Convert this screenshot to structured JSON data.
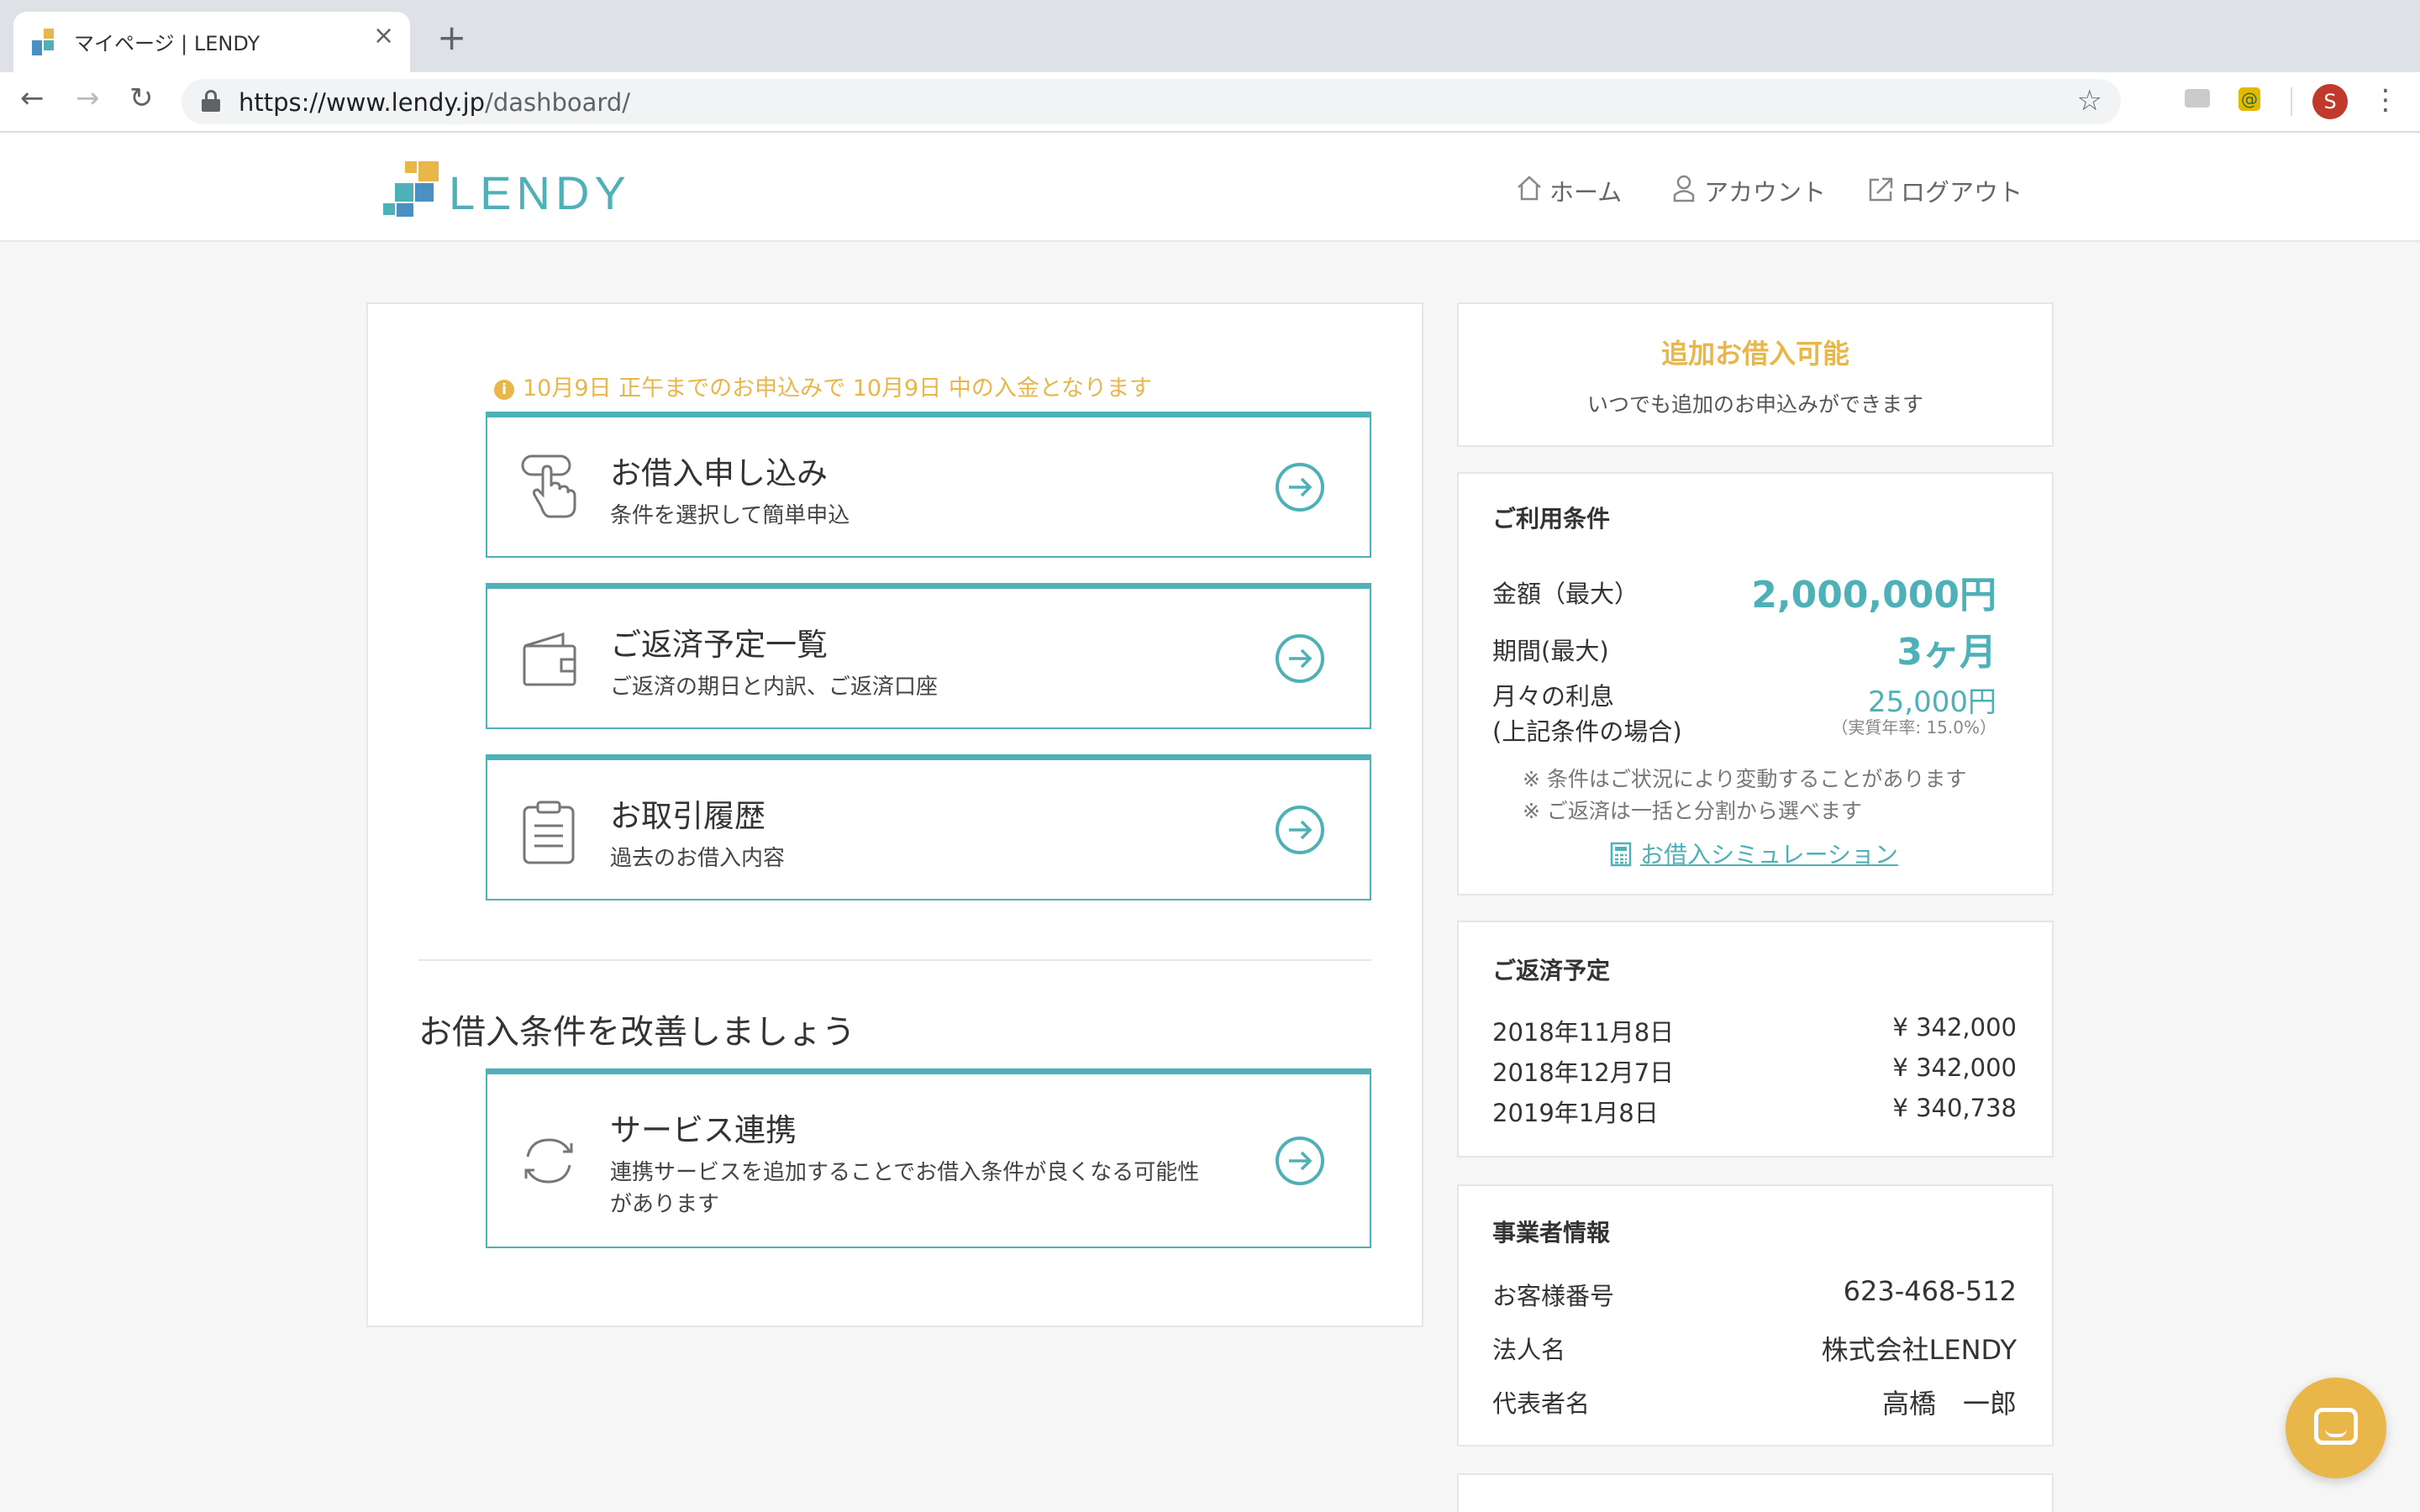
{
  "browser": {
    "tab_title": "マイページ | LENDY",
    "tab_close": "×",
    "new_tab": "+",
    "url_host": "https://www.lendy.jp",
    "url_path": "/dashboard/",
    "ext_label": "@",
    "avatar_letter": "S",
    "back_glyph": "←",
    "forward_glyph": "→",
    "reload_glyph": "↻",
    "star_glyph": "☆",
    "menu_glyph": "⋮"
  },
  "header": {
    "logo": "LENDY",
    "nav": [
      {
        "label": "ホーム",
        "icon": "home-icon"
      },
      {
        "label": "アカウント",
        "icon": "user-icon"
      },
      {
        "label": "ログアウト",
        "icon": "external-link-icon"
      }
    ]
  },
  "notice": {
    "icon": "i",
    "text": "10月9日 正午までのお申込みで 10月9日 中の入金となります"
  },
  "cards": [
    {
      "title": "お借入申し込み",
      "subtitle": "条件を選択して簡単申込",
      "icon": "hand-pointer-icon"
    },
    {
      "title": "ご返済予定一覧",
      "subtitle": "ご返済の期日と内訳、ご返済口座",
      "icon": "wallet-icon"
    },
    {
      "title": "お取引履歴",
      "subtitle": "過去のお借入内容",
      "icon": "clipboard-icon"
    }
  ],
  "improve": {
    "heading": "お借入条件を改善しましょう",
    "card": {
      "title": "サービス連携",
      "subtitle": "連携サービスを追加することでお借入条件が良くなる可能性があります",
      "icon": "sync-icon"
    }
  },
  "additional": {
    "title": "追加お借入可能",
    "subtitle": "いつでも追加のお申込みができます"
  },
  "terms": {
    "title": "ご利用条件",
    "amount_label": "金額（最大）",
    "amount_value": "2,000,000円",
    "period_label": "期間(最大)",
    "period_value": "3ヶ月",
    "interest_label_1": "月々の利息",
    "interest_label_2": "(上記条件の場合)",
    "interest_value": "25,000円",
    "interest_rate": "（実質年率: 15.0%）",
    "notes": [
      "※ 条件はご状況により変動することがあります",
      "※ ご返済は一括と分割から選べます"
    ],
    "simulation_link": "お借入シミュレーション"
  },
  "repayment": {
    "title": "ご返済予定",
    "rows": [
      {
        "date": "2018年11月8日",
        "amount": "¥ 342,000"
      },
      {
        "date": "2018年12月7日",
        "amount": "¥ 342,000"
      },
      {
        "date": "2019年1月8日",
        "amount": "¥ 340,738"
      }
    ]
  },
  "business": {
    "title": "事業者情報",
    "rows": [
      {
        "label": "お客様番号",
        "value": "623-468-512"
      },
      {
        "label": "法人名",
        "value": "株式会社LENDY"
      },
      {
        "label": "代表者名",
        "value": "高橋　一郎"
      }
    ]
  },
  "colors": {
    "teal": "#4fb1b8",
    "gold": "#e9b64a",
    "blue": "#4a90c2"
  }
}
